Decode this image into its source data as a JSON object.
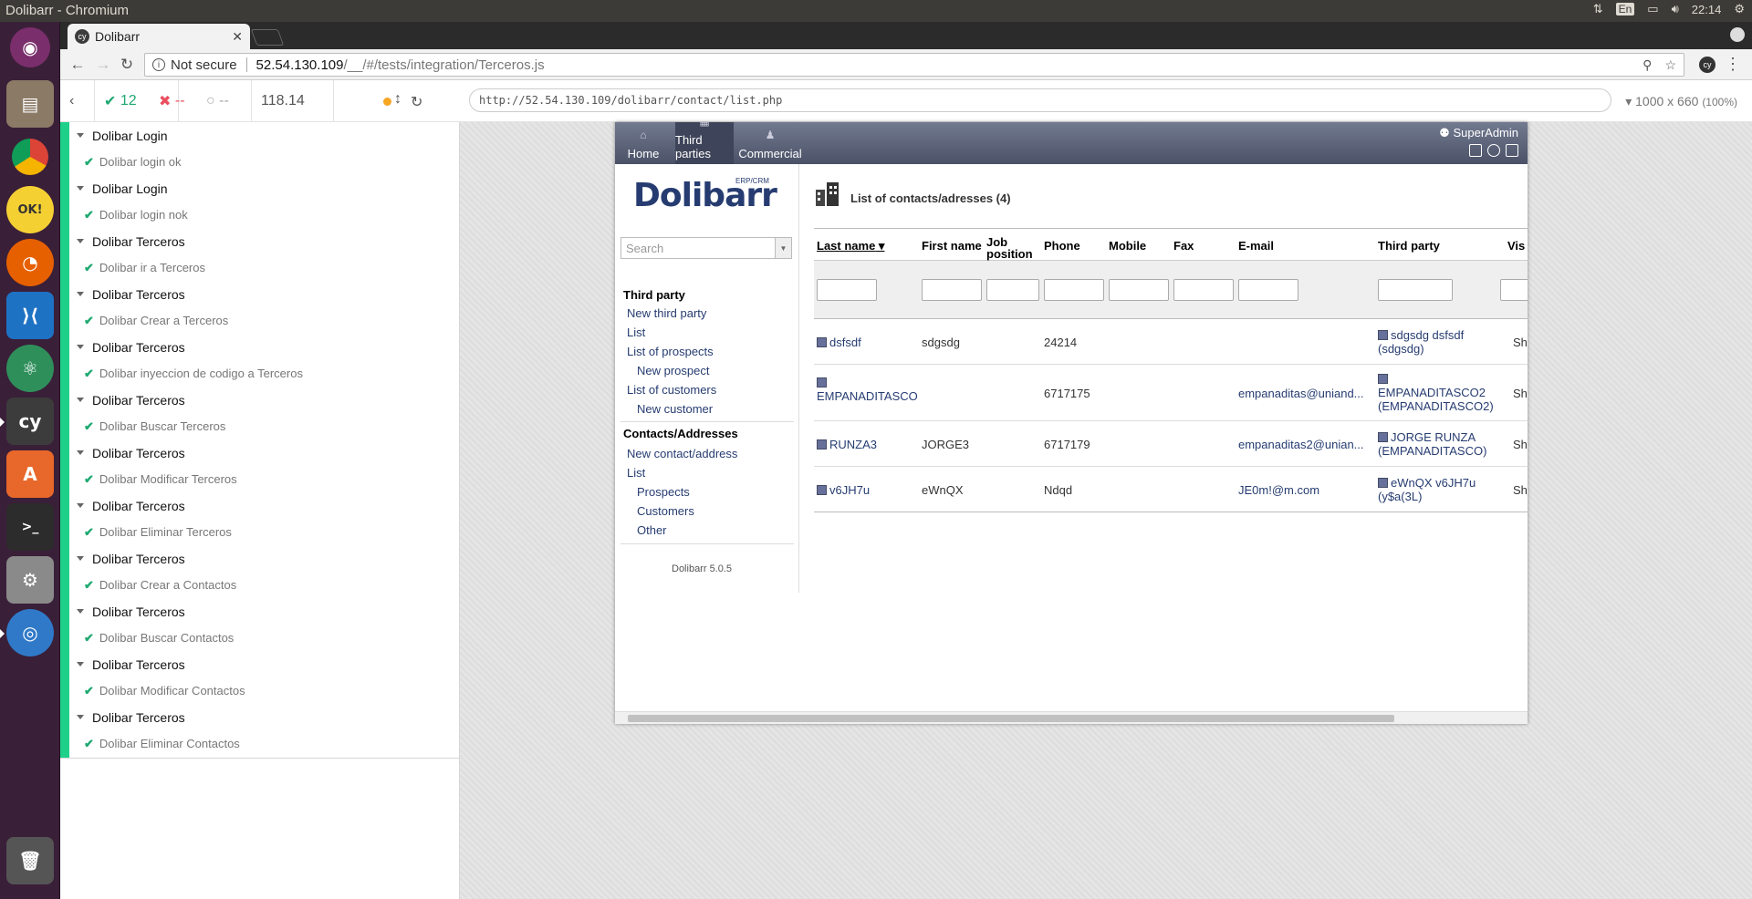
{
  "os": {
    "window_title": "Dolibarr - Chromium",
    "keyboard_layout": "En",
    "clock": "22:14"
  },
  "browser": {
    "tab_title": "Dolibarr",
    "security_label": "Not secure",
    "url_host": "52.54.130.109",
    "url_path": "/__/#/tests/integration/Terceros.js"
  },
  "runner": {
    "passed": "12",
    "failed": "--",
    "pending": "--",
    "duration": "118.14",
    "app_url": "http://52.54.130.109/dolibarr/contact/list.php",
    "viewport": "1000 x 660",
    "viewport_scale": "(100%)",
    "tests": [
      {
        "suite": "Dolibar Login",
        "test": "Dolibar login ok"
      },
      {
        "suite": "Dolibar Login",
        "test": "Dolibar login nok"
      },
      {
        "suite": "Dolibar Terceros",
        "test": "Dolibar ir a Terceros"
      },
      {
        "suite": "Dolibar Terceros",
        "test": "Dolibar Crear a Terceros"
      },
      {
        "suite": "Dolibar Terceros",
        "test": "Dolibar inyeccion de codigo a Terceros"
      },
      {
        "suite": "Dolibar Terceros",
        "test": "Dolibar Buscar Terceros"
      },
      {
        "suite": "Dolibar Terceros",
        "test": "Dolibar Modificar Terceros"
      },
      {
        "suite": "Dolibar Terceros",
        "test": "Dolibar Eliminar Terceros"
      },
      {
        "suite": "Dolibar Terceros",
        "test": "Dolibar Crear a Contactos"
      },
      {
        "suite": "Dolibar Terceros",
        "test": "Dolibar Buscar Contactos"
      },
      {
        "suite": "Dolibar Terceros",
        "test": "Dolibar Modificar Contactos"
      },
      {
        "suite": "Dolibar Terceros",
        "test": "Dolibar Eliminar Contactos"
      }
    ]
  },
  "dolibarr": {
    "menu": {
      "home": "Home",
      "third_parties": "Third parties",
      "commercial": "Commercial"
    },
    "user": "SuperAdmin",
    "logo": "Dolibarr",
    "logo_sub": "ERP/CRM",
    "search_placeholder": "Search",
    "left_menu": {
      "third_party": "Third party",
      "new_third_party": "New third party",
      "list": "List",
      "list_prospects": "List of prospects",
      "new_prospect": "New prospect",
      "list_customers": "List of customers",
      "new_customer": "New customer",
      "contacts": "Contacts/Addresses",
      "new_contact": "New contact/address",
      "list2": "List",
      "prospects": "Prospects",
      "customers": "Customers",
      "other": "Other"
    },
    "version": "Dolibarr 5.0.5",
    "page_title": "List of contacts/adresses (4)",
    "columns": {
      "last_name": "Last name",
      "first_name": "First name",
      "job": "Job position",
      "phone": "Phone",
      "mobile": "Mobile",
      "fax": "Fax",
      "email": "E-mail",
      "third_party": "Third party",
      "visibility": "Vis"
    },
    "rows": [
      {
        "last": "dsfsdf",
        "first": "sdgsdg",
        "phone": "24214",
        "email": "",
        "tp1": "sdgsdg dsfsdf",
        "tp2": "(sdgsdg)",
        "vis": "Sh"
      },
      {
        "last": "EMPANADITASCO",
        "first": "",
        "phone": "6717175",
        "email": "empanaditas@uniand...",
        "tp1": "EMPANADITASCO2",
        "tp2": "(EMPANADITASCO2)",
        "vis": "Sh"
      },
      {
        "last": "RUNZA3",
        "first": "JORGE3",
        "phone": "6717179",
        "email": "empanaditas2@unian...",
        "tp1": "JORGE RUNZA",
        "tp2": "(EMPANADITASCO)",
        "vis": "Sh"
      },
      {
        "last": "v6JH7u",
        "first": "eWnQX",
        "phone": "Ndqd",
        "email": "JE0m!@m.com",
        "tp1": "eWnQX v6JH7u",
        "tp2": "(y$a(3L)",
        "vis": "Sh"
      }
    ]
  }
}
